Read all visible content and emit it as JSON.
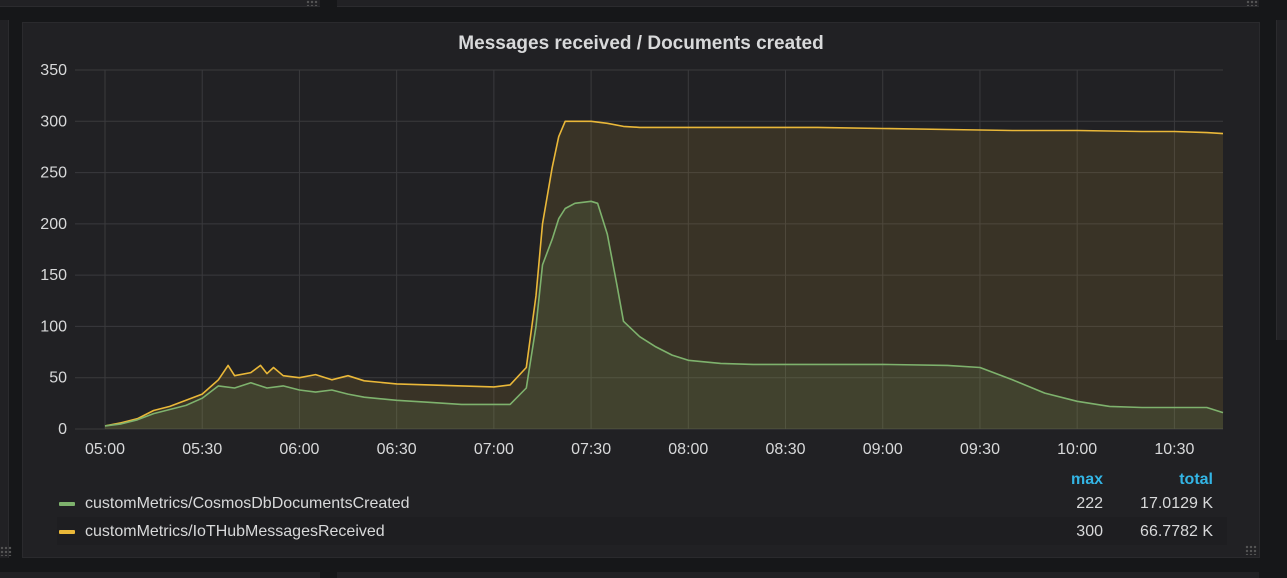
{
  "panel": {
    "title": "Messages received / Documents created"
  },
  "legend": {
    "max_header": "max",
    "total_header": "total",
    "rows": [
      {
        "label": "customMetrics/CosmosDbDocumentsCreated",
        "max": "222",
        "total": "17.0129 K",
        "color": "#7eb26d"
      },
      {
        "label": "customMetrics/IoTHubMessagesReceived",
        "max": "300",
        "total": "66.7782 K",
        "color": "#eab839"
      }
    ]
  },
  "chart_data": {
    "type": "area",
    "title": "Messages received / Documents created",
    "xlabel": "",
    "ylabel": "",
    "ylim": [
      0,
      350
    ],
    "yticks": [
      "0",
      "50",
      "100",
      "150",
      "200",
      "250",
      "300",
      "350"
    ],
    "xticks": [
      "05:00",
      "05:30",
      "06:00",
      "06:30",
      "07:00",
      "07:30",
      "08:00",
      "08:30",
      "09:00",
      "09:30",
      "10:00",
      "10:30"
    ],
    "xlim_minutes": [
      0,
      345
    ],
    "grid": true,
    "legend_position": "bottom",
    "series": [
      {
        "name": "customMetrics/IoTHubMessagesReceived",
        "color": "#eab839",
        "x": [
          0,
          5,
          10,
          15,
          20,
          25,
          30,
          35,
          38,
          40,
          45,
          48,
          50,
          52,
          55,
          60,
          65,
          70,
          75,
          80,
          90,
          100,
          110,
          120,
          125,
          130,
          133,
          135,
          138,
          140,
          142,
          145,
          150,
          155,
          160,
          165,
          170,
          180,
          200,
          220,
          240,
          260,
          280,
          300,
          320,
          330,
          340,
          345
        ],
        "values": [
          3,
          6,
          10,
          18,
          22,
          28,
          34,
          48,
          62,
          52,
          55,
          62,
          54,
          60,
          52,
          50,
          53,
          48,
          52,
          47,
          44,
          43,
          42,
          41,
          43,
          60,
          130,
          200,
          255,
          285,
          300,
          300,
          300,
          298,
          295,
          294,
          294,
          294,
          294,
          294,
          293,
          292,
          291,
          291,
          290,
          290,
          289,
          288
        ]
      },
      {
        "name": "customMetrics/CosmosDbDocumentsCreated",
        "color": "#7eb26d",
        "x": [
          0,
          5,
          10,
          15,
          20,
          25,
          30,
          35,
          40,
          45,
          50,
          55,
          60,
          65,
          70,
          75,
          80,
          90,
          100,
          110,
          120,
          125,
          130,
          133,
          135,
          138,
          140,
          142,
          145,
          150,
          152,
          155,
          158,
          160,
          165,
          170,
          175,
          180,
          190,
          200,
          220,
          240,
          260,
          270,
          280,
          290,
          300,
          310,
          320,
          330,
          340,
          345
        ],
        "values": [
          3,
          5,
          9,
          15,
          19,
          23,
          30,
          42,
          40,
          45,
          40,
          42,
          38,
          36,
          38,
          34,
          31,
          28,
          26,
          24,
          24,
          24,
          40,
          100,
          160,
          185,
          205,
          215,
          220,
          222,
          220,
          190,
          140,
          105,
          90,
          80,
          72,
          67,
          64,
          63,
          63,
          63,
          62,
          60,
          48,
          35,
          27,
          22,
          21,
          21,
          21,
          16
        ]
      }
    ]
  }
}
